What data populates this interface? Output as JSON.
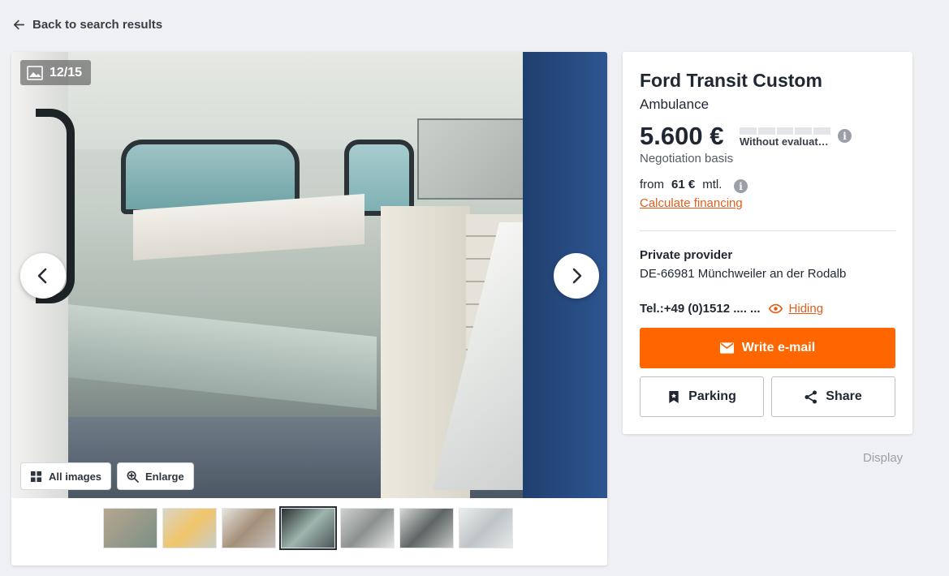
{
  "nav": {
    "back_label": "Back to search results"
  },
  "gallery": {
    "counter": "12/15",
    "all_images_label": "All images",
    "enlarge_label": "Enlarge",
    "thumbnail_count": 7,
    "selected_thumbnail": 4
  },
  "listing": {
    "title": "Ford Transit Custom",
    "subtitle": "Ambulance",
    "price": "5.600 €",
    "evaluation": "Without evaluat…",
    "negotiation": "Negotiation basis",
    "financing": {
      "from": "from",
      "amount": "61 €",
      "period": "mtl.",
      "link": "Calculate financing"
    },
    "provider_type": "Private provider",
    "location": "DE-66981 Münchweiler an der Rodalb",
    "phone": "Tel.:+49 (0)1512 .... ...",
    "hiding_label": "Hiding",
    "email_button": "Write e-mail",
    "parking_button": "Parking",
    "share_button": "Share"
  },
  "footer": {
    "display_label": "Display"
  },
  "colors": {
    "accent": "#ff6600",
    "link": "#e35d1a",
    "background": "#eff0f3"
  }
}
